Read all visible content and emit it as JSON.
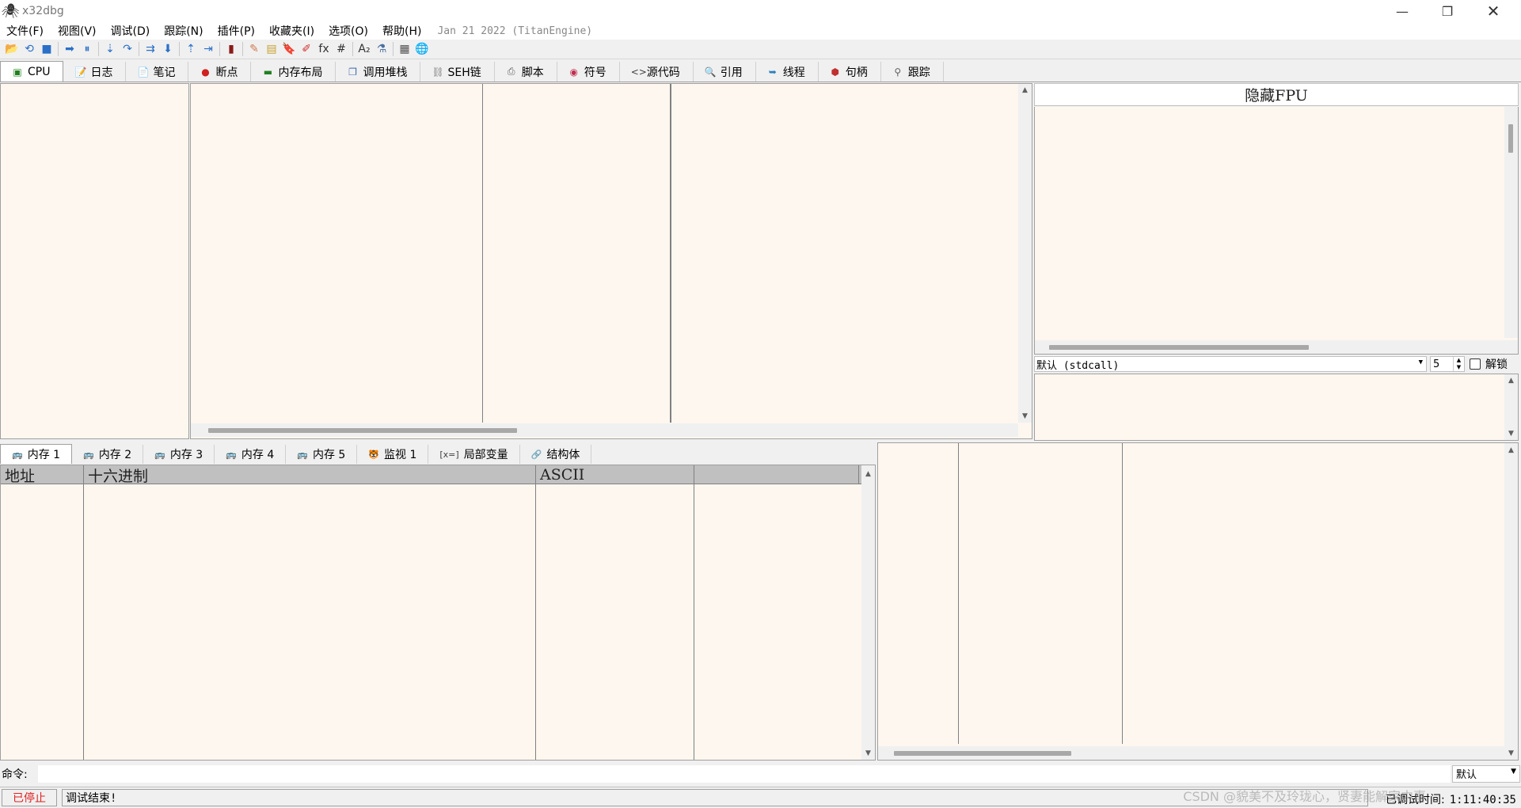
{
  "window": {
    "title": "x32dbg",
    "minimize": "—",
    "maximize": "❐",
    "close": "✕"
  },
  "menu": {
    "items": [
      "文件(F)",
      "视图(V)",
      "调试(D)",
      "跟踪(N)",
      "插件(P)",
      "收藏夹(I)",
      "选项(O)",
      "帮助(H)"
    ],
    "build_info": "Jan 21 2022 (TitanEngine)"
  },
  "toolbar": {
    "buttons": [
      {
        "icon": "open-icon",
        "glyph": "📂",
        "color": "#d8a23a"
      },
      {
        "icon": "restart-icon",
        "glyph": "⟲",
        "color": "#2a70c8"
      },
      {
        "icon": "stop-icon",
        "glyph": "■",
        "color": "#2a70c8"
      },
      {
        "sep": true
      },
      {
        "icon": "run-icon",
        "glyph": "➡",
        "color": "#2a70c8"
      },
      {
        "icon": "pause-icon",
        "glyph": "⏸",
        "color": "#2a70c8"
      },
      {
        "sep": true
      },
      {
        "icon": "step-into-icon",
        "glyph": "⇣",
        "color": "#2a70c8"
      },
      {
        "icon": "step-over-icon",
        "glyph": "↷",
        "color": "#2a70c8"
      },
      {
        "sep": true
      },
      {
        "icon": "trace-into-icon",
        "glyph": "⇉",
        "color": "#2a70c8"
      },
      {
        "icon": "trace-over-icon",
        "glyph": "⬇",
        "color": "#2a70c8"
      },
      {
        "sep": true
      },
      {
        "icon": "execute-till-return-icon",
        "glyph": "⇡",
        "color": "#2a70c8"
      },
      {
        "icon": "run-to-user-code-icon",
        "glyph": "⇥",
        "color": "#2a70c8"
      },
      {
        "sep": true
      },
      {
        "icon": "scylla-icon",
        "glyph": "▮",
        "color": "#8a1a1a"
      },
      {
        "sep": true
      },
      {
        "icon": "comment-icon",
        "glyph": "✎",
        "color": "#d07a50"
      },
      {
        "icon": "label-icon",
        "glyph": "▤",
        "color": "#c8a030"
      },
      {
        "icon": "bookmark-icon",
        "glyph": "🔖",
        "color": "#4a90c0"
      },
      {
        "icon": "function-highlight-icon",
        "glyph": "✐",
        "color": "#d03030"
      },
      {
        "icon": "function-icon",
        "glyph": "fx",
        "color": "#333333"
      },
      {
        "icon": "hash-icon",
        "glyph": "#",
        "color": "#333333"
      },
      {
        "sep": true
      },
      {
        "icon": "strings-icon",
        "glyph": "A₂",
        "color": "#333333"
      },
      {
        "icon": "patches-icon",
        "glyph": "⚗",
        "color": "#4a70a0"
      },
      {
        "sep": true
      },
      {
        "icon": "calculator-icon",
        "glyph": "▦",
        "color": "#505050"
      },
      {
        "icon": "web-icon",
        "glyph": "🌐",
        "color": "#2a80b0"
      }
    ]
  },
  "main_tabs": [
    {
      "label": "CPU",
      "icon": "cpu-icon",
      "glyph": "▣",
      "color": "#208020",
      "active": true
    },
    {
      "label": "日志",
      "icon": "log-icon",
      "glyph": "📝",
      "color": "#606060"
    },
    {
      "label": "笔记",
      "icon": "notes-icon",
      "glyph": "📄",
      "color": "#606060"
    },
    {
      "label": "断点",
      "icon": "breakpoint-icon",
      "glyph": "●",
      "color": "#d02020"
    },
    {
      "label": "内存布局",
      "icon": "memory-map-icon",
      "glyph": "▬",
      "color": "#208020"
    },
    {
      "label": "调用堆栈",
      "icon": "call-stack-icon",
      "glyph": "❐",
      "color": "#3a6ab0"
    },
    {
      "label": "SEH链",
      "icon": "seh-icon",
      "glyph": "⛓",
      "color": "#808080"
    },
    {
      "label": "脚本",
      "icon": "script-icon",
      "glyph": "⎙",
      "color": "#606060"
    },
    {
      "label": "符号",
      "icon": "symbols-icon",
      "glyph": "◉",
      "color": "#c03050"
    },
    {
      "label": "源代码",
      "icon": "source-icon",
      "glyph": "<>",
      "color": "#404040"
    },
    {
      "label": "引用",
      "icon": "references-icon",
      "glyph": "🔍",
      "color": "#606060"
    },
    {
      "label": "线程",
      "icon": "threads-icon",
      "glyph": "➥",
      "color": "#2a80c0"
    },
    {
      "label": "句柄",
      "icon": "handles-icon",
      "glyph": "⬢",
      "color": "#c03030"
    },
    {
      "label": "跟踪",
      "icon": "trace-icon",
      "glyph": "⚲",
      "color": "#606060"
    }
  ],
  "registers": {
    "header": "隐藏FPU"
  },
  "call_convention": {
    "selected": "默认 (stdcall)",
    "arg_count": "5",
    "unlock_label": "解锁"
  },
  "dump_tabs": [
    {
      "label": "内存 1",
      "icon": "dump-icon",
      "glyph": "🚌",
      "color": "#606060",
      "active": true
    },
    {
      "label": "内存 2",
      "icon": "dump-icon",
      "glyph": "🚌",
      "color": "#606060"
    },
    {
      "label": "内存 3",
      "icon": "dump-icon",
      "glyph": "🚌",
      "color": "#606060"
    },
    {
      "label": "内存 4",
      "icon": "dump-icon",
      "glyph": "🚌",
      "color": "#606060"
    },
    {
      "label": "内存 5",
      "icon": "dump-icon",
      "glyph": "🚌",
      "color": "#606060"
    },
    {
      "label": "监视 1",
      "icon": "watch-icon",
      "glyph": "🐯",
      "color": "#d08030"
    },
    {
      "label": "局部变量",
      "icon": "locals-icon",
      "glyph": "[x=]",
      "color": "#404040"
    },
    {
      "label": "结构体",
      "icon": "struct-icon",
      "glyph": "🔗",
      "color": "#d03030"
    }
  ],
  "dump": {
    "columns": [
      "地址",
      "十六进制",
      "ASCII",
      ""
    ]
  },
  "command": {
    "label": "命令:",
    "value": "",
    "mode": "默认"
  },
  "status": {
    "state": "已停止",
    "message": "调试结束!",
    "time_label": "已调试时间:",
    "time_value": "1:11:40:35"
  },
  "watermark": "CSDN @貌美不及玲珑心，贤妻能解家中事",
  "colors": {
    "pane_bg": "#fef7ef",
    "status_stopped": "#e02020"
  }
}
